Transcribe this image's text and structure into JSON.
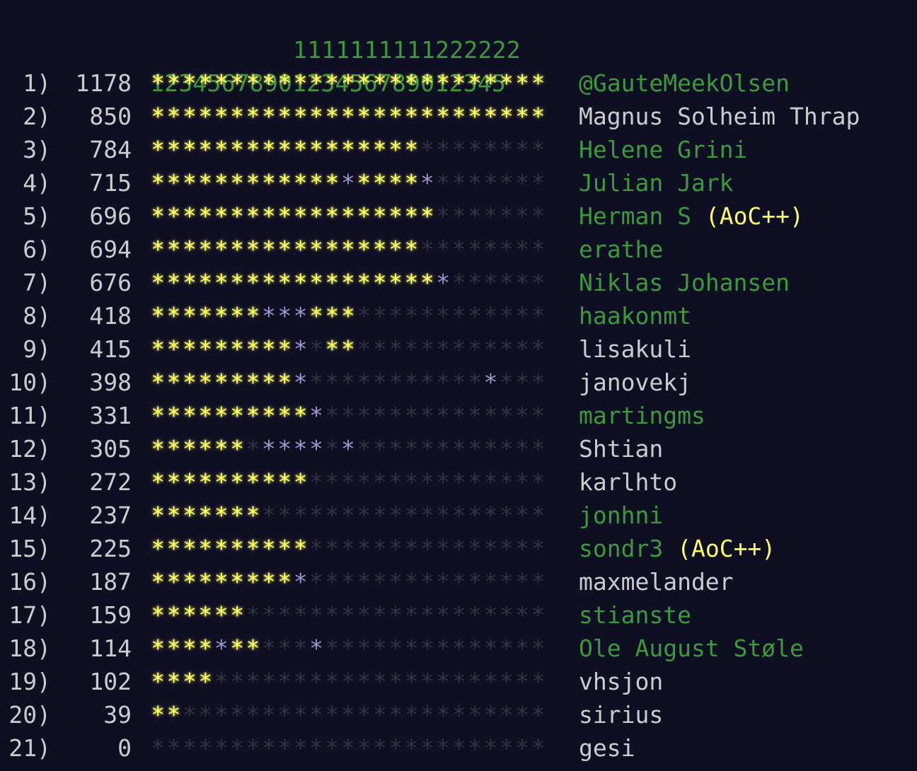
{
  "header": {
    "tens_row": "1111111111222222",
    "units_row": "1234567890123456789012345"
  },
  "colors": {
    "background": "#0f0f23",
    "gold_star": "#ffff66",
    "silver_star": "#9999cc",
    "empty_star": "#333340",
    "link_name": "#3c9a3c",
    "plain_name": "#cccccc",
    "supporter": "#ffff66"
  },
  "star_legend": {
    "2": "both-parts",
    "1": "first-part-only",
    "0": "not-started"
  },
  "entries": [
    {
      "rank": "1)",
      "score": "1178",
      "stars": "2222222222222222222222222",
      "name": "@GauteMeekOlsen",
      "linked": true,
      "supporter": ""
    },
    {
      "rank": "2)",
      "score": "850",
      "stars": "2222222222222222222222222",
      "name": "Magnus Solheim Thrap",
      "linked": false,
      "supporter": ""
    },
    {
      "rank": "3)",
      "score": "784",
      "stars": "2222222222222222200000000",
      "name": "Helene Grini",
      "linked": true,
      "supporter": ""
    },
    {
      "rank": "4)",
      "score": "715",
      "stars": "2222222222221222210000000",
      "name": "Julian Jark",
      "linked": true,
      "supporter": ""
    },
    {
      "rank": "5)",
      "score": "696",
      "stars": "2222222222222222220000000",
      "name": "Herman S",
      "linked": true,
      "supporter": "(AoC++)"
    },
    {
      "rank": "6)",
      "score": "694",
      "stars": "2222222222222222200000000",
      "name": "erathe",
      "linked": true,
      "supporter": ""
    },
    {
      "rank": "7)",
      "score": "676",
      "stars": "2222222222222222221000000",
      "name": "Niklas Johansen",
      "linked": true,
      "supporter": ""
    },
    {
      "rank": "8)",
      "score": "418",
      "stars": "2222222111222000000000000",
      "name": "haakonmt",
      "linked": true,
      "supporter": ""
    },
    {
      "rank": "9)",
      "score": "415",
      "stars": "2222222221022000000000000",
      "name": "lisakuli",
      "linked": false,
      "supporter": ""
    },
    {
      "rank": "10)",
      "score": "398",
      "stars": "2222222221000000000001000",
      "name": "janovekj",
      "linked": false,
      "supporter": ""
    },
    {
      "rank": "11)",
      "score": "331",
      "stars": "2222222222100000000000000",
      "name": "martingms",
      "linked": true,
      "supporter": ""
    },
    {
      "rank": "12)",
      "score": "305",
      "stars": "2222220111101000000000000",
      "name": "Shtian",
      "linked": false,
      "supporter": ""
    },
    {
      "rank": "13)",
      "score": "272",
      "stars": "2222222222000000000000000",
      "name": "karlhto",
      "linked": false,
      "supporter": ""
    },
    {
      "rank": "14)",
      "score": "237",
      "stars": "2222222000000000000000000",
      "name": "jonhni",
      "linked": true,
      "supporter": ""
    },
    {
      "rank": "15)",
      "score": "225",
      "stars": "2222222222000000000000000",
      "name": "sondr3",
      "linked": true,
      "supporter": "(AoC++)"
    },
    {
      "rank": "16)",
      "score": "187",
      "stars": "2222222221000000000000000",
      "name": "maxmelander",
      "linked": false,
      "supporter": ""
    },
    {
      "rank": "17)",
      "score": "159",
      "stars": "2222220000000000000000000",
      "name": "stianste",
      "linked": true,
      "supporter": ""
    },
    {
      "rank": "18)",
      "score": "114",
      "stars": "2222122000100000000000000",
      "name": "Ole August Støle",
      "linked": true,
      "supporter": ""
    },
    {
      "rank": "19)",
      "score": "102",
      "stars": "2222000000000000000000000",
      "name": "vhsjon",
      "linked": false,
      "supporter": ""
    },
    {
      "rank": "20)",
      "score": "39",
      "stars": "2200000000000000000000000",
      "name": "sirius",
      "linked": false,
      "supporter": ""
    },
    {
      "rank": "21)",
      "score": "0",
      "stars": "0000000000000000000000000",
      "name": "gesi",
      "linked": false,
      "supporter": ""
    }
  ]
}
